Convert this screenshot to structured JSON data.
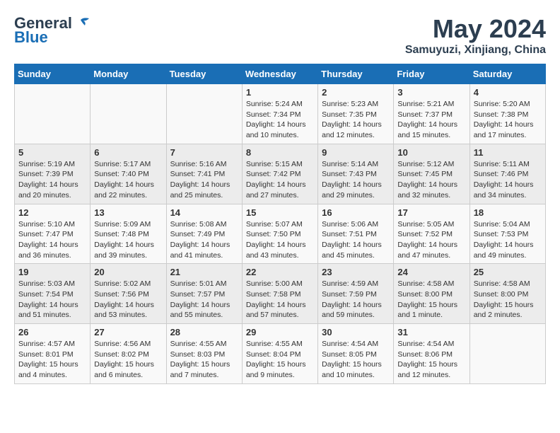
{
  "logo": {
    "line1": "General",
    "line2": "Blue"
  },
  "title": "May 2024",
  "location": "Samuyuzi, Xinjiang, China",
  "weekdays": [
    "Sunday",
    "Monday",
    "Tuesday",
    "Wednesday",
    "Thursday",
    "Friday",
    "Saturday"
  ],
  "weeks": [
    [
      {
        "day": "",
        "sunrise": "",
        "sunset": "",
        "daylight": ""
      },
      {
        "day": "",
        "sunrise": "",
        "sunset": "",
        "daylight": ""
      },
      {
        "day": "",
        "sunrise": "",
        "sunset": "",
        "daylight": ""
      },
      {
        "day": "1",
        "sunrise": "Sunrise: 5:24 AM",
        "sunset": "Sunset: 7:34 PM",
        "daylight": "Daylight: 14 hours and 10 minutes."
      },
      {
        "day": "2",
        "sunrise": "Sunrise: 5:23 AM",
        "sunset": "Sunset: 7:35 PM",
        "daylight": "Daylight: 14 hours and 12 minutes."
      },
      {
        "day": "3",
        "sunrise": "Sunrise: 5:21 AM",
        "sunset": "Sunset: 7:37 PM",
        "daylight": "Daylight: 14 hours and 15 minutes."
      },
      {
        "day": "4",
        "sunrise": "Sunrise: 5:20 AM",
        "sunset": "Sunset: 7:38 PM",
        "daylight": "Daylight: 14 hours and 17 minutes."
      }
    ],
    [
      {
        "day": "5",
        "sunrise": "Sunrise: 5:19 AM",
        "sunset": "Sunset: 7:39 PM",
        "daylight": "Daylight: 14 hours and 20 minutes."
      },
      {
        "day": "6",
        "sunrise": "Sunrise: 5:17 AM",
        "sunset": "Sunset: 7:40 PM",
        "daylight": "Daylight: 14 hours and 22 minutes."
      },
      {
        "day": "7",
        "sunrise": "Sunrise: 5:16 AM",
        "sunset": "Sunset: 7:41 PM",
        "daylight": "Daylight: 14 hours and 25 minutes."
      },
      {
        "day": "8",
        "sunrise": "Sunrise: 5:15 AM",
        "sunset": "Sunset: 7:42 PM",
        "daylight": "Daylight: 14 hours and 27 minutes."
      },
      {
        "day": "9",
        "sunrise": "Sunrise: 5:14 AM",
        "sunset": "Sunset: 7:43 PM",
        "daylight": "Daylight: 14 hours and 29 minutes."
      },
      {
        "day": "10",
        "sunrise": "Sunrise: 5:12 AM",
        "sunset": "Sunset: 7:45 PM",
        "daylight": "Daylight: 14 hours and 32 minutes."
      },
      {
        "day": "11",
        "sunrise": "Sunrise: 5:11 AM",
        "sunset": "Sunset: 7:46 PM",
        "daylight": "Daylight: 14 hours and 34 minutes."
      }
    ],
    [
      {
        "day": "12",
        "sunrise": "Sunrise: 5:10 AM",
        "sunset": "Sunset: 7:47 PM",
        "daylight": "Daylight: 14 hours and 36 minutes."
      },
      {
        "day": "13",
        "sunrise": "Sunrise: 5:09 AM",
        "sunset": "Sunset: 7:48 PM",
        "daylight": "Daylight: 14 hours and 39 minutes."
      },
      {
        "day": "14",
        "sunrise": "Sunrise: 5:08 AM",
        "sunset": "Sunset: 7:49 PM",
        "daylight": "Daylight: 14 hours and 41 minutes."
      },
      {
        "day": "15",
        "sunrise": "Sunrise: 5:07 AM",
        "sunset": "Sunset: 7:50 PM",
        "daylight": "Daylight: 14 hours and 43 minutes."
      },
      {
        "day": "16",
        "sunrise": "Sunrise: 5:06 AM",
        "sunset": "Sunset: 7:51 PM",
        "daylight": "Daylight: 14 hours and 45 minutes."
      },
      {
        "day": "17",
        "sunrise": "Sunrise: 5:05 AM",
        "sunset": "Sunset: 7:52 PM",
        "daylight": "Daylight: 14 hours and 47 minutes."
      },
      {
        "day": "18",
        "sunrise": "Sunrise: 5:04 AM",
        "sunset": "Sunset: 7:53 PM",
        "daylight": "Daylight: 14 hours and 49 minutes."
      }
    ],
    [
      {
        "day": "19",
        "sunrise": "Sunrise: 5:03 AM",
        "sunset": "Sunset: 7:54 PM",
        "daylight": "Daylight: 14 hours and 51 minutes."
      },
      {
        "day": "20",
        "sunrise": "Sunrise: 5:02 AM",
        "sunset": "Sunset: 7:56 PM",
        "daylight": "Daylight: 14 hours and 53 minutes."
      },
      {
        "day": "21",
        "sunrise": "Sunrise: 5:01 AM",
        "sunset": "Sunset: 7:57 PM",
        "daylight": "Daylight: 14 hours and 55 minutes."
      },
      {
        "day": "22",
        "sunrise": "Sunrise: 5:00 AM",
        "sunset": "Sunset: 7:58 PM",
        "daylight": "Daylight: 14 hours and 57 minutes."
      },
      {
        "day": "23",
        "sunrise": "Sunrise: 4:59 AM",
        "sunset": "Sunset: 7:59 PM",
        "daylight": "Daylight: 14 hours and 59 minutes."
      },
      {
        "day": "24",
        "sunrise": "Sunrise: 4:58 AM",
        "sunset": "Sunset: 8:00 PM",
        "daylight": "Daylight: 15 hours and 1 minute."
      },
      {
        "day": "25",
        "sunrise": "Sunrise: 4:58 AM",
        "sunset": "Sunset: 8:00 PM",
        "daylight": "Daylight: 15 hours and 2 minutes."
      }
    ],
    [
      {
        "day": "26",
        "sunrise": "Sunrise: 4:57 AM",
        "sunset": "Sunset: 8:01 PM",
        "daylight": "Daylight: 15 hours and 4 minutes."
      },
      {
        "day": "27",
        "sunrise": "Sunrise: 4:56 AM",
        "sunset": "Sunset: 8:02 PM",
        "daylight": "Daylight: 15 hours and 6 minutes."
      },
      {
        "day": "28",
        "sunrise": "Sunrise: 4:55 AM",
        "sunset": "Sunset: 8:03 PM",
        "daylight": "Daylight: 15 hours and 7 minutes."
      },
      {
        "day": "29",
        "sunrise": "Sunrise: 4:55 AM",
        "sunset": "Sunset: 8:04 PM",
        "daylight": "Daylight: 15 hours and 9 minutes."
      },
      {
        "day": "30",
        "sunrise": "Sunrise: 4:54 AM",
        "sunset": "Sunset: 8:05 PM",
        "daylight": "Daylight: 15 hours and 10 minutes."
      },
      {
        "day": "31",
        "sunrise": "Sunrise: 4:54 AM",
        "sunset": "Sunset: 8:06 PM",
        "daylight": "Daylight: 15 hours and 12 minutes."
      },
      {
        "day": "",
        "sunrise": "",
        "sunset": "",
        "daylight": ""
      }
    ]
  ]
}
